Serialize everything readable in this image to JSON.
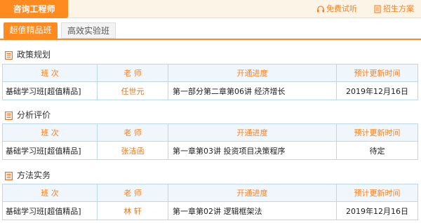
{
  "header": {
    "brand": "咨询工程师",
    "trial_label": "免费试听",
    "plan_label": "招生方案"
  },
  "tabs": [
    {
      "label": "超值精品班",
      "active": true
    },
    {
      "label": "高效实验班",
      "active": false
    }
  ],
  "columns": [
    "班  次",
    "老  师",
    "开通进度",
    "预计更新时间"
  ],
  "sections": [
    {
      "title": "政策规划",
      "row": {
        "class": "基础学习班[超值精品]",
        "teacher": "任世元",
        "progress": "第一部分第二章第06讲  经济增长",
        "update": "2019年12月16日"
      }
    },
    {
      "title": "分析评价",
      "row": {
        "class": "基础学习班[超值精品]",
        "teacher": "张洁函",
        "progress": "第一章第03讲  投资项目决策程序",
        "update": "待定"
      }
    },
    {
      "title": "方法实务",
      "row": {
        "class": "基础学习班[超值精品]",
        "teacher": "林  轩",
        "progress": "第一章第02讲  逻辑框架法",
        "update": "2019年12月16日"
      }
    }
  ],
  "colors": {
    "accent": "#ff8a1f",
    "header_bg": "#fdf4e8",
    "table_border": "#bcd7ea",
    "table_head_bg": "#f0f7fc"
  }
}
